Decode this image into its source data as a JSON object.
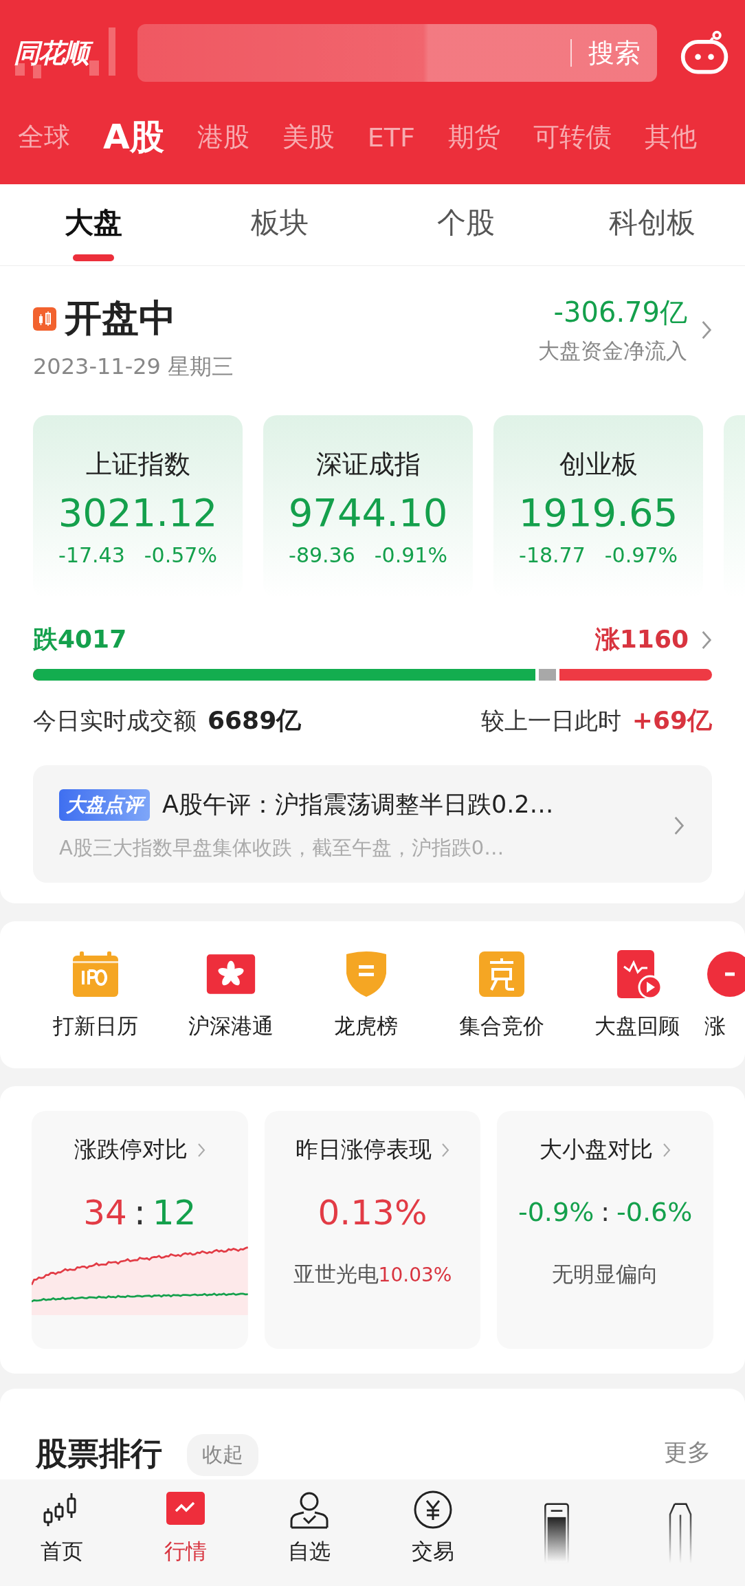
{
  "header": {
    "logo": "同花顺",
    "search_button": "搜索"
  },
  "market_tabs": [
    {
      "label": "全球",
      "selected": false
    },
    {
      "label": "A股",
      "selected": true
    },
    {
      "label": "港股",
      "selected": false
    },
    {
      "label": "美股",
      "selected": false
    },
    {
      "label": "ETF",
      "selected": false
    },
    {
      "label": "期货",
      "selected": false
    },
    {
      "label": "可转债",
      "selected": false
    },
    {
      "label": "其他",
      "selected": false
    }
  ],
  "sub_tabs": [
    {
      "label": "大盘",
      "selected": true
    },
    {
      "label": "板块",
      "selected": false
    },
    {
      "label": "个股",
      "selected": false
    },
    {
      "label": "科创板",
      "selected": false
    }
  ],
  "status": {
    "title": "开盘中",
    "date": "2023-11-29 星期三",
    "net_flow": "-306.79亿",
    "net_flow_label": "大盘资金净流入"
  },
  "indices": [
    {
      "name": "上证指数",
      "value": "3021.12",
      "change": "-17.43",
      "percent": "-0.57%",
      "color": "#14a04c"
    },
    {
      "name": "深证成指",
      "value": "9744.10",
      "change": "-89.36",
      "percent": "-0.91%",
      "color": "#14a04c"
    },
    {
      "name": "创业板",
      "value": "1919.65",
      "change": "-18.77",
      "percent": "-0.97%",
      "color": "#14a04c"
    }
  ],
  "breadth": {
    "fall": "跌4017",
    "rise": "涨1160",
    "level": 0.74
  },
  "turnover": {
    "label": "今日实时成交额",
    "value": "6689亿",
    "compare_label": "较上一日此时",
    "compare_value": "+69亿"
  },
  "commentary": {
    "tag": "大盘点评",
    "title": "A股午评：沪指震荡调整半日跌0.2…",
    "summary": "A股三大指数早盘集体收跌，截至午盘，沪指跌0…"
  },
  "shortcuts": [
    {
      "label": "打新日历",
      "kind": "ipo"
    },
    {
      "label": "沪深港通",
      "kind": "hk"
    },
    {
      "label": "龙虎榜",
      "kind": "shield"
    },
    {
      "label": "集合竞价",
      "kind": "auction"
    },
    {
      "label": "大盘回顾",
      "kind": "review"
    },
    {
      "label": "涨",
      "kind": "limit"
    }
  ],
  "stat_cards": [
    {
      "kind": "ratio",
      "title": "涨跌停对比",
      "values": [
        {
          "text": "34",
          "color": "#e23b45"
        },
        {
          "text": "12",
          "color": "#14a04c"
        }
      ],
      "separator": ":"
    },
    {
      "kind": "single",
      "title": "昨日涨停表现",
      "value": "0.13%",
      "stock": "亚世光电",
      "stock_change": "10.03%"
    },
    {
      "kind": "compare",
      "title": "大小盘对比",
      "values": [
        {
          "text": "-0.9%",
          "color": "#14a04c"
        },
        {
          "text": "-0.6%",
          "color": "#14a04c"
        }
      ],
      "separator": ":",
      "note": "无明显偏向"
    }
  ],
  "ranking": {
    "title": "股票排行",
    "collapse": "收起",
    "more": "更多"
  },
  "bottom_nav": [
    {
      "label": "首页",
      "kind": "candles",
      "selected": false
    },
    {
      "label": "行情",
      "kind": "chart",
      "selected": true
    },
    {
      "label": "自选",
      "kind": "person",
      "selected": false
    },
    {
      "label": "交易",
      "kind": "yuan",
      "selected": false
    },
    {
      "kind": "phone"
    },
    {
      "kind": "bottle"
    }
  ]
}
